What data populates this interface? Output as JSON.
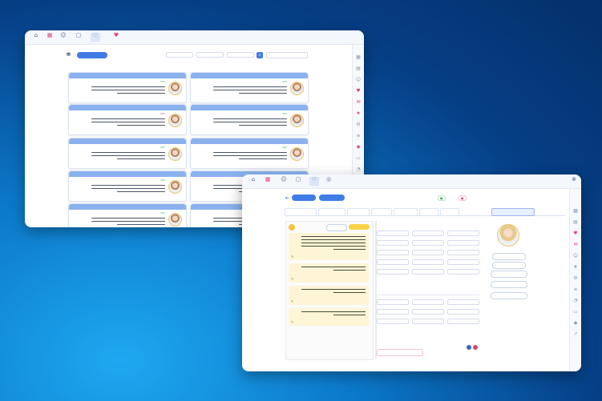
{
  "back_window": {
    "top_icons": [
      "",
      "",
      "",
      "",
      "",
      ""
    ],
    "app_title": "",
    "logo": "",
    "add_button": "",
    "search_label": "",
    "cards": [
      {
        "name": "",
        "time": "",
        "tag": "",
        "tag_color": "green"
      },
      {
        "name": "",
        "time": "",
        "tag": "",
        "tag_color": "green"
      },
      {
        "name": "",
        "time": "",
        "tag": "",
        "tag_color": "green"
      },
      {
        "name": "",
        "time": "",
        "tag": "",
        "tag_color": "pink"
      },
      {
        "name": "",
        "time": "",
        "tag": "",
        "tag_color": "green"
      },
      {
        "name": "",
        "time": "",
        "tag": "",
        "tag_color": "green"
      },
      {
        "name": "",
        "time": "",
        "tag": "",
        "tag_color": "green"
      },
      {
        "name": "",
        "time": "",
        "tag": "",
        "tag_color": "green"
      },
      {
        "name": "",
        "time": "",
        "tag": "",
        "tag_color": "green"
      },
      {
        "name": "",
        "time": "",
        "tag": "",
        "tag_color": "green"
      }
    ]
  },
  "front_window": {
    "app_title": "",
    "logo": "",
    "header_buttons": [
      "",
      ""
    ],
    "profile_title": "",
    "tabs": [
      "",
      "",
      "",
      "",
      "",
      "",
      ""
    ],
    "notes_count": 4,
    "profile_buttons": [
      "",
      "",
      "",
      ""
    ],
    "bottom_link": "",
    "bottom_right": ""
  },
  "colors": {
    "accent": "#3f7ce6",
    "card_header": "#8bb2ee",
    "note_bg": "#fdf5d5",
    "tag_green": "#36b556",
    "tag_pink": "#e0457b",
    "background_top": "#04306a",
    "background_glow": "#1ea8f0"
  },
  "icons": {
    "sidebar": [
      "calendar-icon",
      "chart-icon",
      "users-icon",
      "heart-icon",
      "message-icon",
      "star-icon",
      "settings-icon",
      "list-icon"
    ],
    "top": [
      "home-icon",
      "calendar-icon",
      "people-icon",
      "chat-icon",
      "heart-icon",
      "user-icon"
    ]
  }
}
